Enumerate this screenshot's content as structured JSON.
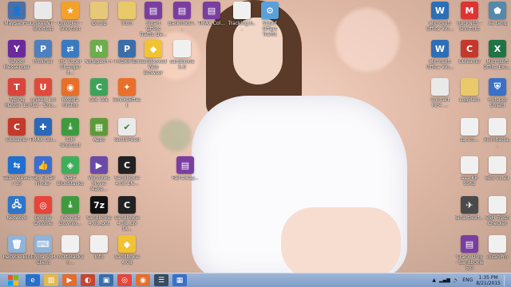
{
  "desktop": {
    "icons": [
      {
        "label": "MaySaoPC",
        "icon": "user-icon",
        "color": "#4b6fa8",
        "glyph": "👤"
      },
      {
        "label": "UnikeyNT - Shortcut",
        "icon": "unikey-icon",
        "color": "#e9e9e9",
        "glyph": ""
      },
      {
        "label": "Unlocker - Shortcut",
        "icon": "unlocker-icon",
        "color": "#f3a12a",
        "glyph": "★"
      },
      {
        "label": "ipv.zip",
        "icon": "zip-folder-icon",
        "color": "#e6c878",
        "glyph": ""
      },
      {
        "label": "intro",
        "icon": "folder-icon",
        "color": "#e9c96a",
        "glyph": ""
      },
      {
        "label": "Smart Offers Traffic Ge...",
        "icon": "winrar-icon",
        "color": "#7a3ea0",
        "glyph": "▤"
      },
      {
        "label": "BacklinksT...",
        "icon": "winrar-icon",
        "color": "#7a3ea0",
        "glyph": "▤"
      },
      {
        "label": "TMAX Col...",
        "icon": "winrar-icon",
        "color": "#7a3ea0",
        "glyph": "▤"
      },
      {
        "label": "Tracking.b...",
        "icon": "file-icon",
        "color": "#f0f0f0",
        "glyph": ""
      },
      {
        "label": "Smart Offers Traffic",
        "icon": "app-icon",
        "color": "#5aa0d8",
        "glyph": "⚙"
      },
      {
        "label": "Microsoft Office Wo...",
        "icon": "office-icon",
        "color": "#2d6fb6",
        "glyph": "W"
      },
      {
        "label": "RockNES - Shortcut",
        "icon": "mario-icon",
        "color": "#d33",
        "glyph": "M"
      },
      {
        "label": "Xe tang",
        "icon": "tank-icon",
        "color": "#58a",
        "glyph": "⬟"
      },
      {
        "label": "Yahoo! Messenger",
        "icon": "yahoo-icon",
        "color": "#6b2a9c",
        "glyph": "Y"
      },
      {
        "label": "Proxifier",
        "icon": "proxifier-icon",
        "color": "#4e7fbf",
        "glyph": "P"
      },
      {
        "label": "HC Super Changer It...",
        "icon": "network-icon",
        "color": "#3a7ac0",
        "glyph": "⇄"
      },
      {
        "label": "Notepad++",
        "icon": "notepad-icon",
        "color": "#6cae4d",
        "glyph": "N"
      },
      {
        "label": "PROXIFIER",
        "icon": "proxifier-icon",
        "color": "#3b6ea8",
        "glyph": "P"
      },
      {
        "label": "Sandboxed Web Browser",
        "icon": "sandboxie-icon",
        "color": "#f1c232",
        "glyph": "◆"
      },
      {
        "label": "sandboxie 5.0",
        "icon": "file-icon",
        "color": "#f0f0f0",
        "glyph": ""
      },
      {
        "label": "Microsoft Office Wo...",
        "icon": "office-icon",
        "color": "#2d6fb6",
        "glyph": "W"
      },
      {
        "label": "CCleaner",
        "icon": "ccleaner-icon",
        "color": "#c3392b",
        "glyph": "C"
      },
      {
        "label": "Microsoft Office Exc...",
        "icon": "excel-icon",
        "color": "#217346",
        "glyph": "X"
      },
      {
        "label": "Typing Master 10",
        "icon": "typing-icon",
        "color": "#d8453c",
        "glyph": "T"
      },
      {
        "label": "unikey 4.0 RC2 - Sho...",
        "icon": "unikey-icon",
        "color": "#e04a3a",
        "glyph": "U"
      },
      {
        "label": "Mozilla Firefox",
        "icon": "firefox-icon",
        "color": "#e6702b",
        "glyph": "◉"
      },
      {
        "label": "Cốc Cốc",
        "icon": "coccoc-icon",
        "color": "#3ea35a",
        "glyph": "C"
      },
      {
        "label": "SmokeEffect",
        "icon": "smoke-icon",
        "color": "#e8702b",
        "glyph": "✦"
      },
      {
        "label": "Convert MP4 ...",
        "icon": "file-icon",
        "color": "#e9e9e9",
        "glyph": ""
      },
      {
        "label": "LogMeIn",
        "icon": "folder-icon",
        "color": "#e9c96a",
        "glyph": ""
      },
      {
        "label": "Hotspot Shield",
        "icon": "shield-icon",
        "color": "#3a70c8",
        "glyph": "⛨"
      },
      {
        "label": "CCleaner",
        "icon": "ccleaner-icon",
        "color": "#c3392b",
        "glyph": "C"
      },
      {
        "label": "TMAX Col...",
        "icon": "tmax-icon",
        "color": "#2a68b8",
        "glyph": "✚"
      },
      {
        "label": "IDM Shortcut",
        "icon": "idm-icon",
        "color": "#3f9a3f",
        "glyph": "⤓"
      },
      {
        "label": "Apps",
        "icon": "apps-icon",
        "color": "#5e9a3a",
        "glyph": "▦"
      },
      {
        "label": "SocialFeed",
        "icon": "check-icon",
        "color": "#eaeaea",
        "glyph": "✔"
      },
      {
        "label": "sa.ico...",
        "icon": "file-icon",
        "color": "#f0f0f0",
        "glyph": ""
      },
      {
        "label": "Xiembatra...",
        "icon": "file-icon",
        "color": "#f0f0f0",
        "glyph": ""
      },
      {
        "label": "TeamViewer 10",
        "icon": "teamviewer-icon",
        "color": "#1f6fd0",
        "glyph": "⇆"
      },
      {
        "label": "Tap Email Finder",
        "icon": "thumbs-up-icon",
        "color": "#3b6fd1",
        "glyph": "👍"
      },
      {
        "label": "Start BlueStacks",
        "icon": "bluestacks-icon",
        "color": "#3fae5a",
        "glyph": "◈"
      },
      {
        "label": "Windows Movie Make...",
        "icon": "movie-icon",
        "color": "#6a4aa8",
        "glyph": "▶"
      },
      {
        "label": "Sandboxie 4.08 EN...",
        "icon": "challenger-icon",
        "color": "#222",
        "glyph": "C"
      },
      {
        "label": "Fall-away...",
        "icon": "winrar-icon",
        "color": "#7a3ea0",
        "glyph": "▤"
      },
      {
        "label": "aaa.KB 5562",
        "icon": "file-icon",
        "color": "#f0f0f0",
        "glyph": ""
      },
      {
        "label": "BLS v1.21",
        "icon": "file-icon",
        "color": "#f0f0f0",
        "glyph": ""
      },
      {
        "label": "Network",
        "icon": "network-icon",
        "color": "#2e74c8",
        "glyph": "🖧"
      },
      {
        "label": "Google Chrome",
        "icon": "chrome-icon",
        "color": "#e8443a",
        "glyph": "◎"
      },
      {
        "label": "Internet Downlo...",
        "icon": "idm-icon",
        "color": "#3f9a3f",
        "glyph": "⤓"
      },
      {
        "label": "Sandboxie 4.08_pot",
        "icon": "7z-icon",
        "color": "#111",
        "glyph": "7z"
      },
      {
        "label": "Sandboxie 4.08_EN TA...",
        "icon": "challenger-icon",
        "color": "#222",
        "glyph": "C"
      },
      {
        "label": "SmartSurf...",
        "icon": "smartsurf-icon",
        "color": "#4a4a4a",
        "glyph": "✈"
      },
      {
        "label": "SSH Fresh Checker",
        "icon": "file-icon",
        "color": "#f0f0f0",
        "glyph": ""
      },
      {
        "label": "Recycle Bin",
        "icon": "recycle-icon",
        "color": "#8fb3d9",
        "glyph": "🗑"
      },
      {
        "label": "Elvira SSH Client",
        "icon": "ssh-icon",
        "color": "#8fb3d9",
        "glyph": "⌨"
      },
      {
        "label": "multiBacklin...",
        "icon": "file-icon",
        "color": "#f0f0f0",
        "glyph": ""
      },
      {
        "label": "Info",
        "icon": "file-icon",
        "color": "#f0f0f0",
        "glyph": ""
      },
      {
        "label": "Sandboxie 4.08",
        "icon": "sandboxie-icon",
        "color": "#f1c232",
        "glyph": "◆"
      },
      {
        "label": "Crack Only - Sandboxie 5.0",
        "icon": "winrar-icon",
        "color": "#7a3ea0",
        "glyph": "▤"
      },
      {
        "label": "iScanPro",
        "icon": "file-icon",
        "color": "#f0f0f0",
        "glyph": ""
      }
    ]
  },
  "taskbar": {
    "pinned": [
      {
        "name": "ie",
        "glyph": "e",
        "color": "#2a6fc8"
      },
      {
        "name": "explorer",
        "glyph": "▥",
        "color": "#e6b84a"
      },
      {
        "name": "media",
        "glyph": "▶",
        "color": "#e76b2b"
      },
      {
        "name": "app1",
        "glyph": "◐",
        "color": "#c8452e"
      },
      {
        "name": "app2",
        "glyph": "▣",
        "color": "#3b6ea8"
      },
      {
        "name": "chrome",
        "glyph": "◎",
        "color": "#e8443a"
      },
      {
        "name": "firefox",
        "glyph": "◉",
        "color": "#e6702b"
      },
      {
        "name": "app3",
        "glyph": "☰",
        "color": "#3a4b5c"
      },
      {
        "name": "app4",
        "glyph": "▦",
        "color": "#3a70c8"
      }
    ],
    "tray": {
      "lang": "ENG",
      "time": "1:35 PM",
      "date": "8/21/2015"
    }
  }
}
